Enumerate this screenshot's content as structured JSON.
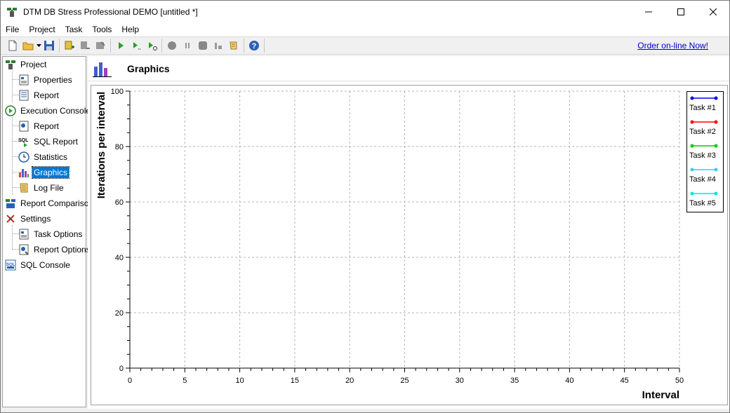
{
  "window": {
    "title": "DTM DB Stress Professional DEMO [untitled *]"
  },
  "menu": [
    "File",
    "Project",
    "Task",
    "Tools",
    "Help"
  ],
  "toolbar": {
    "order_link": "Order on-line Now!"
  },
  "tree": [
    {
      "label": "Project",
      "icon": "project-icon",
      "level": 0
    },
    {
      "label": "Properties",
      "icon": "properties-icon",
      "level": 1
    },
    {
      "label": "Report",
      "icon": "report-icon",
      "level": 1
    },
    {
      "label": "Execution Console",
      "icon": "execution-console-icon",
      "level": 0
    },
    {
      "label": "Report",
      "icon": "report-icon",
      "level": 1
    },
    {
      "label": "SQL Report",
      "icon": "sql-report-icon",
      "level": 1
    },
    {
      "label": "Statistics",
      "icon": "clock-icon",
      "level": 1
    },
    {
      "label": "Graphics",
      "icon": "bar-chart-icon",
      "level": 1,
      "selected": true
    },
    {
      "label": "Log File",
      "icon": "scroll-icon",
      "level": 1
    },
    {
      "label": "Report Comparison",
      "icon": "report-comparison-icon",
      "level": 0
    },
    {
      "label": "Settings",
      "icon": "settings-icon",
      "level": 0
    },
    {
      "label": "Task Options",
      "icon": "task-options-icon",
      "level": 1
    },
    {
      "label": "Report Options",
      "icon": "report-options-icon",
      "level": 1
    },
    {
      "label": "SQL Console",
      "icon": "sql-console-icon",
      "level": 0
    }
  ],
  "main": {
    "title": "Graphics"
  },
  "chart_data": {
    "type": "line",
    "xlabel": "Interval",
    "ylabel": "Iterations per interval",
    "xlim": [
      0,
      50
    ],
    "ylim": [
      0,
      100
    ],
    "xticks": [
      0,
      5,
      10,
      15,
      20,
      25,
      30,
      35,
      40,
      45,
      50
    ],
    "yticks": [
      0,
      20,
      40,
      60,
      80,
      100
    ],
    "grid": true,
    "legend_position": "top-right",
    "series": [
      {
        "name": "Task #1",
        "color": "#0000ff",
        "values": []
      },
      {
        "name": "Task #2",
        "color": "#ff0000",
        "values": []
      },
      {
        "name": "Task #3",
        "color": "#00cc00",
        "values": []
      },
      {
        "name": "Task #4",
        "color": "#33ccff",
        "values": []
      },
      {
        "name": "Task #5",
        "color": "#00e5e5",
        "values": []
      }
    ]
  }
}
